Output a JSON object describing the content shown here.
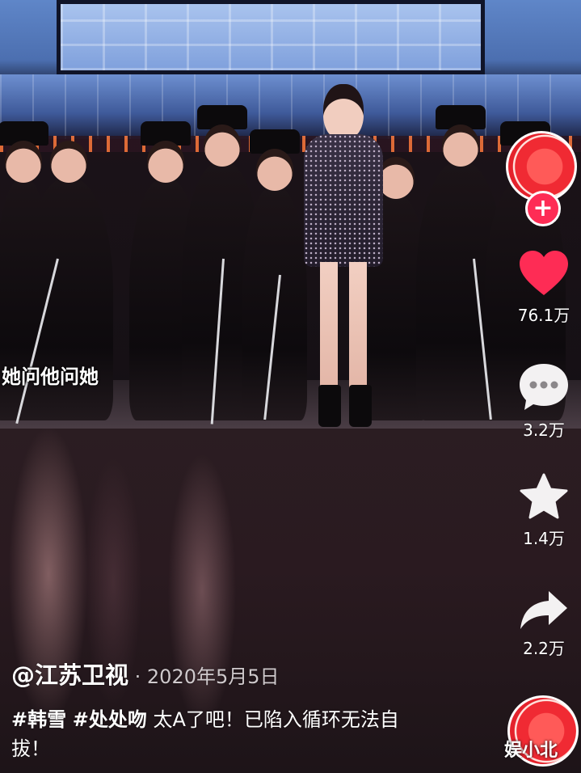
{
  "video": {
    "caption": "她问他问她"
  },
  "actions": {
    "like_count": "76.1万",
    "comment_count": "3.2万",
    "favorite_count": "1.4万",
    "share_count": "2.2万",
    "follow_symbol": "+"
  },
  "post": {
    "author": "@江苏卫视",
    "separator": " · ",
    "date": "2020年5月5日",
    "hashtags": [
      "#韩雪",
      "#处处吻"
    ],
    "text": " 太A了吧！已陷入循环无法自拔！"
  },
  "watermark": "娱小北",
  "colors": {
    "like_red": "#fe2c55",
    "follow_red": "#fe2c55"
  },
  "icons": {
    "like": "heart-icon",
    "comment": "comment-bubble-icon",
    "favorite": "star-icon",
    "share": "share-arrow-icon"
  }
}
